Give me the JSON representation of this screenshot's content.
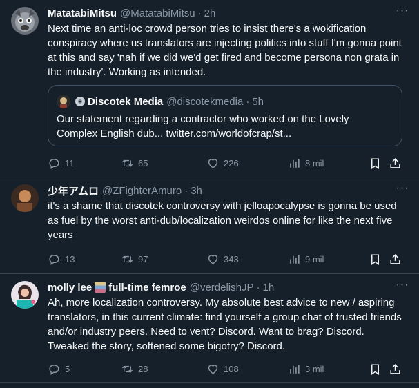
{
  "tweets": [
    {
      "display_name": "MatatabiMitsu",
      "handle": "@MatatabiMitsu",
      "separator": "·",
      "time": "2h",
      "text": "Next time an anti-loc crowd person tries to insist there's a wokification conspiracy where us translators are injecting politics into stuff I'm gonna point at this and say 'nah if we did we'd get fired and become persona non grata in the industry'. Working as intended.",
      "quote": {
        "display_name": "Discotek Media",
        "handle": "@discotekmedia",
        "separator": "·",
        "time": "5h",
        "text": "Our statement regarding a contractor who worked on the Lovely Complex English dub... twitter.com/worldofcrap/st..."
      },
      "replies": "11",
      "retweets": "65",
      "likes": "226",
      "views": "8 mil"
    },
    {
      "display_name": "少年アムロ",
      "handle": "@ZFighterAmuro",
      "separator": "·",
      "time": "3h",
      "text": "it's a shame that discotek controversy with jelloapocalypse is gonna be used as fuel by the worst anti-dub/localization weirdos online for like the next five years",
      "replies": "13",
      "retweets": "97",
      "likes": "343",
      "views": "9 mil"
    },
    {
      "display_name": "molly lee",
      "name_suffix": "full-time femroe",
      "handle": "@verdelishJP",
      "separator": "·",
      "time": "1h",
      "text": "Ah, more localization controversy. My absolute best advice to new / aspiring translators, in this current climate: find yourself a group chat of trusted friends and/or industry peers. Need to vent? Discord. Want to brag? Discord. Tweaked the story, softened some bigotry? Discord.",
      "replies": "5",
      "retweets": "28",
      "likes": "108",
      "views": "3 mil"
    }
  ],
  "more_glyph": "···",
  "colors": {
    "background": "#15202b",
    "text": "#f7f9f9",
    "secondary": "#8b98a5",
    "border": "#38444d"
  }
}
